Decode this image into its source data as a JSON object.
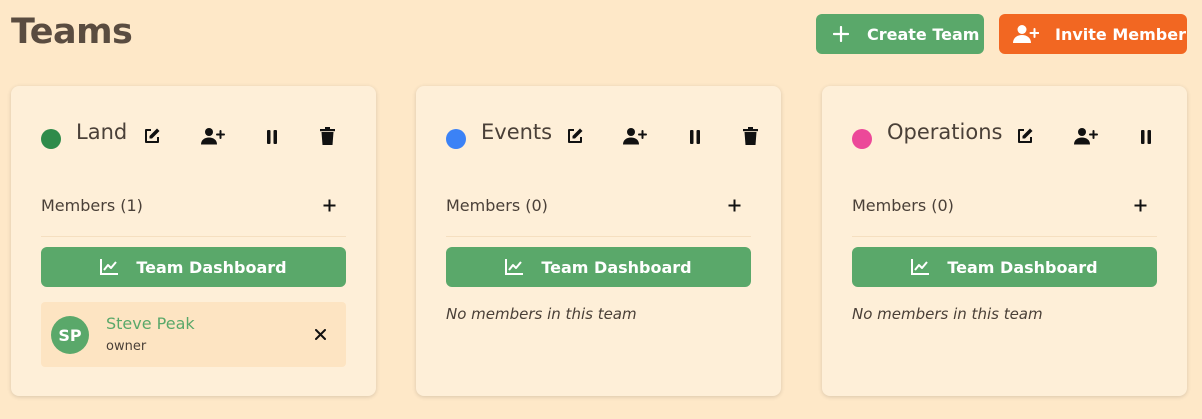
{
  "header": {
    "title": "Teams",
    "create_team_label": "Create Team",
    "invite_member_label": "Invite Member"
  },
  "colors": {
    "green": "#5aa86a",
    "orange": "#f26722",
    "land_dot": "#2e8b4a",
    "events_dot": "#3b82f6",
    "operations_dot": "#ec4899"
  },
  "teams": [
    {
      "name": "Land",
      "members_label": "Members (1)",
      "dashboard_label": "Team Dashboard",
      "members": [
        {
          "initials": "SP",
          "name": "Steve Peak",
          "role": "owner"
        }
      ]
    },
    {
      "name": "Events",
      "members_label": "Members (0)",
      "dashboard_label": "Team Dashboard",
      "empty_text": "No members in this team"
    },
    {
      "name": "Operations",
      "members_label": "Members (0)",
      "dashboard_label": "Team Dashboard",
      "empty_text": "No members in this team"
    }
  ]
}
